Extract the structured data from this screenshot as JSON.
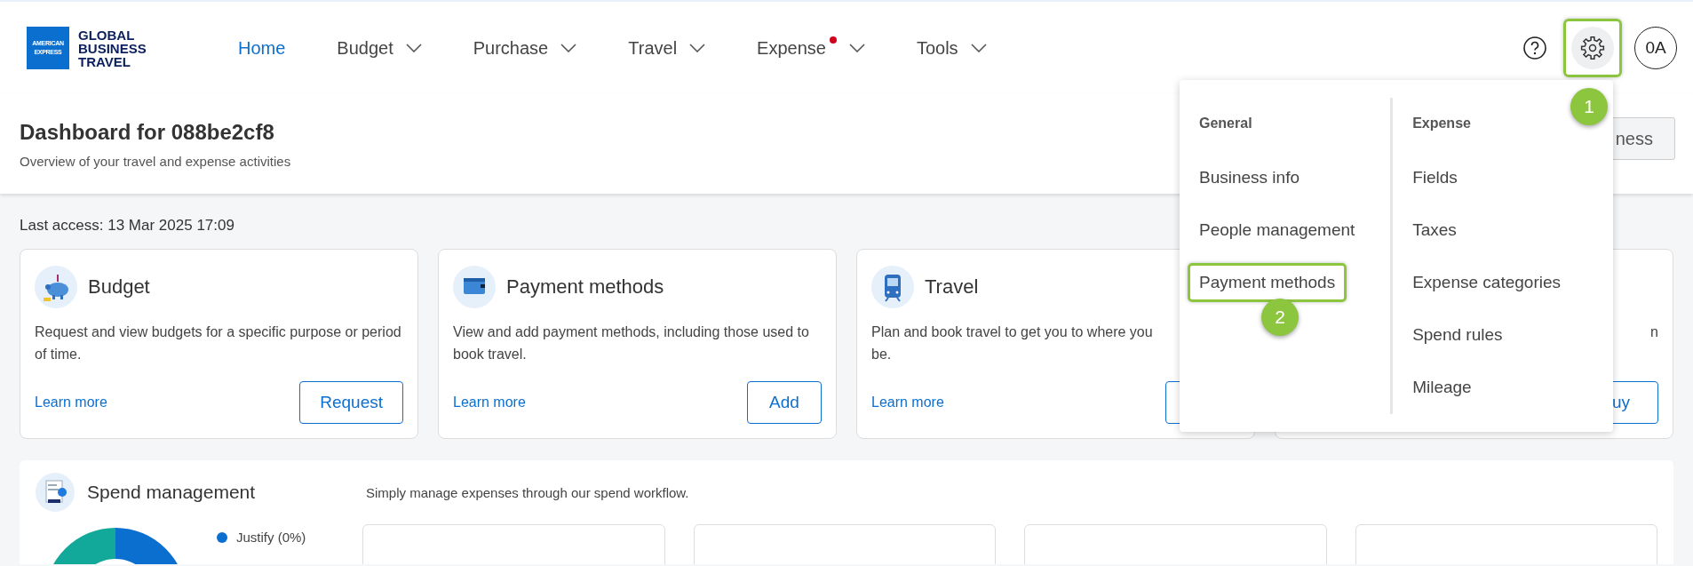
{
  "logo": {
    "badge_lines": [
      "AMERICAN",
      "EXPRESS"
    ],
    "wordmark_lines": [
      "GLOBAL",
      "BUSINESS",
      "TRAVEL"
    ]
  },
  "nav": [
    {
      "label": "Home",
      "selected": true,
      "dropdown": false,
      "notification": false
    },
    {
      "label": "Budget",
      "selected": false,
      "dropdown": true,
      "notification": false
    },
    {
      "label": "Purchase",
      "selected": false,
      "dropdown": true,
      "notification": false
    },
    {
      "label": "Travel",
      "selected": false,
      "dropdown": true,
      "notification": false
    },
    {
      "label": "Expense",
      "selected": false,
      "dropdown": true,
      "notification": true
    },
    {
      "label": "Tools",
      "selected": false,
      "dropdown": true,
      "notification": false
    }
  ],
  "toolbar": {
    "settings": {
      "highlighted": true,
      "callout": "1"
    },
    "avatar": "0A"
  },
  "dashboard": {
    "title": "Dashboard for 088be2cf8",
    "subtitle": "Overview of your travel and expense activities",
    "button": "ness"
  },
  "last_access": "Last access: 13 Mar 2025 17:09",
  "cards": [
    {
      "kind": "budget",
      "title": "Budget",
      "description": "Request and view budgets for a specific purpose or period of time.",
      "link": "Learn more",
      "button": "Request"
    },
    {
      "kind": "payment",
      "title": "Payment methods",
      "description": "View and add payment methods, including those used to book travel.",
      "link": "Learn more",
      "button": "Add"
    },
    {
      "kind": "travel",
      "title": "Travel",
      "description": "Plan and book travel to get you to where you\nbe.",
      "link": "Learn more"
    },
    {
      "kind": "partial",
      "description": "n",
      "button": "uy"
    }
  ],
  "settings_menu": {
    "columns": [
      {
        "heading": "General",
        "items": [
          {
            "label": "Business info",
            "highlighted": false
          },
          {
            "label": "People management",
            "highlighted": false
          },
          {
            "label": "Payment methods",
            "highlighted": true,
            "callout": "2"
          }
        ]
      },
      {
        "heading": "Expense",
        "items": [
          {
            "label": "Fields",
            "highlighted": false
          },
          {
            "label": "Taxes",
            "highlighted": false
          },
          {
            "label": "Expense categories",
            "highlighted": false
          },
          {
            "label": "Spend rules",
            "highlighted": false
          },
          {
            "label": "Mileage",
            "highlighted": false
          }
        ]
      }
    ]
  },
  "spend": {
    "title": "Spend management",
    "description": "Simply manage expenses through our spend workflow.",
    "legend": [
      {
        "label": "Justify (0%)",
        "color": "#0b6fd0"
      }
    ]
  }
}
